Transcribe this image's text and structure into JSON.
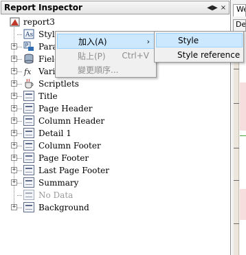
{
  "panel": {
    "title": "Report Inspector",
    "controls": [
      "◀▶",
      "×"
    ]
  },
  "tree": {
    "root": "report3",
    "nodes": [
      {
        "label": "Styles",
        "icon": "styles-icon",
        "expander": false
      },
      {
        "label": "Parameters",
        "icon": "parameters-icon",
        "expander": true
      },
      {
        "label": "Fields",
        "icon": "fields-icon",
        "expander": true
      },
      {
        "label": "Variables",
        "icon": "variables-icon",
        "expander": true
      },
      {
        "label": "Scriptlets",
        "icon": "scriptlets-icon",
        "expander": true
      },
      {
        "label": "Title",
        "icon": "band-icon",
        "expander": true
      },
      {
        "label": "Page Header",
        "icon": "band-icon",
        "expander": true
      },
      {
        "label": "Column Header",
        "icon": "band-icon",
        "expander": true
      },
      {
        "label": "Detail 1",
        "icon": "band-icon",
        "expander": true
      },
      {
        "label": "Column Footer",
        "icon": "band-icon",
        "expander": true
      },
      {
        "label": "Page Footer",
        "icon": "band-icon",
        "expander": true
      },
      {
        "label": "Last Page Footer",
        "icon": "band-icon",
        "expander": true
      },
      {
        "label": "Summary",
        "icon": "band-icon",
        "expander": true
      },
      {
        "label": "No Data",
        "icon": "band-icon",
        "expander": false,
        "dim": true
      },
      {
        "label": "Background",
        "icon": "band-icon",
        "expander": true
      }
    ]
  },
  "context_menu": {
    "items": [
      {
        "label": "加入(A)",
        "shortcut": "",
        "submenu": true,
        "enabled": true,
        "highlighted": true
      },
      {
        "label": "貼上(P)",
        "shortcut": "Ctrl+V",
        "submenu": false,
        "enabled": false
      },
      {
        "label": "變更順序...",
        "shortcut": "",
        "submenu": false,
        "enabled": false
      }
    ]
  },
  "submenu": {
    "items": [
      {
        "label": "Style",
        "highlighted": true
      },
      {
        "label": "Style reference",
        "highlighted": false
      }
    ]
  },
  "right_tabs": [
    "We",
    "De"
  ]
}
